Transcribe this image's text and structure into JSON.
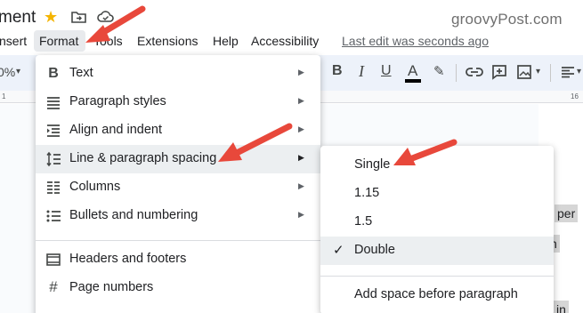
{
  "header": {
    "title": "ment",
    "watermark": "groovyPost.com"
  },
  "menubar": {
    "insert": "nsert",
    "format": "Format",
    "tools": "Tools",
    "extensions": "Extensions",
    "help": "Help",
    "accessibility": "Accessibility",
    "last_edit": "Last edit was seconds ago"
  },
  "toolbar": {
    "zoom": "0%",
    "font_size_partial": "",
    "bold": "B",
    "italic": "I",
    "underline": "U",
    "text_color": "A"
  },
  "ruler": {
    "mark_left": "1",
    "mark_right": "16"
  },
  "format_menu": {
    "items": [
      {
        "label": "Text",
        "icon": "bold-icon",
        "has_submenu": true
      },
      {
        "label": "Paragraph styles",
        "icon": "paragraph-styles-icon",
        "has_submenu": true
      },
      {
        "label": "Align and indent",
        "icon": "align-icon",
        "has_submenu": true
      },
      {
        "label": "Line & paragraph spacing",
        "icon": "line-spacing-icon",
        "has_submenu": true,
        "highlighted": true
      },
      {
        "label": "Columns",
        "icon": "columns-icon",
        "has_submenu": true
      },
      {
        "label": "Bullets and numbering",
        "icon": "bullets-icon",
        "has_submenu": true
      },
      {
        "label": "Headers and footers",
        "icon": "header-footer-icon",
        "has_submenu": false
      },
      {
        "label": "Page numbers",
        "icon": "hash-icon",
        "has_submenu": false
      }
    ]
  },
  "spacing_submenu": {
    "items": [
      {
        "label": "Single",
        "checked": false,
        "highlighted": false
      },
      {
        "label": "1.15",
        "checked": false,
        "highlighted": false
      },
      {
        "label": "1.5",
        "checked": false,
        "highlighted": false
      },
      {
        "label": "Double",
        "checked": true,
        "highlighted": true
      }
    ],
    "add_space": "Add space before paragraph"
  },
  "document": {
    "frag1": "per",
    "frag2": "n",
    "frag3": "in"
  },
  "colors": {
    "arrow": "#e8483b",
    "star": "#f4b400",
    "hover": "#eceff1",
    "toolbar_bg": "#edf2fa"
  }
}
